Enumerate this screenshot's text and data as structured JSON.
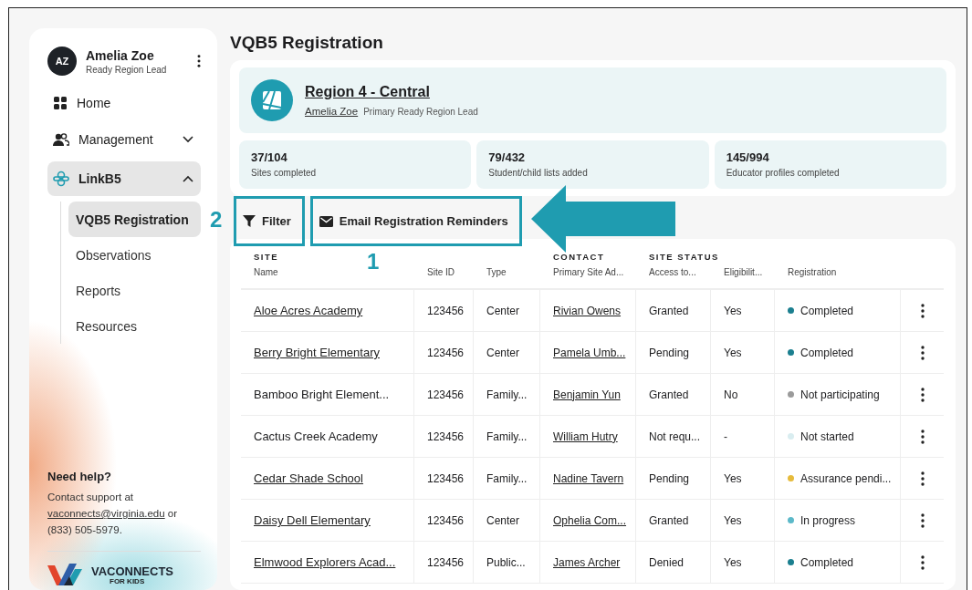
{
  "user": {
    "initials": "AZ",
    "name": "Amelia Zoe",
    "role": "Ready Region Lead"
  },
  "nav": [
    {
      "label": "Home",
      "selected": false
    },
    {
      "label": "Management",
      "selected": false,
      "expanded": false
    },
    {
      "label": "LinkB5",
      "selected": true,
      "expanded": true,
      "children": [
        {
          "label": "VQB5 Registration",
          "selected": true
        },
        {
          "label": "Observations",
          "selected": false
        },
        {
          "label": "Reports",
          "selected": false
        },
        {
          "label": "Resources",
          "selected": false
        }
      ]
    }
  ],
  "help": {
    "title": "Need help?",
    "text": "Contact support at",
    "email": "vaconnects@virginia.edu",
    "text_after": "or",
    "phone": "(833) 505-5979."
  },
  "logo": {
    "name": "VACONNECTS",
    "tagline": "FOR KIDS"
  },
  "page_title": "VQB5 Registration",
  "region": {
    "title": "Region 4 - Central",
    "lead": "Amelia Zoe",
    "lead_role": "Primary Ready Region Lead"
  },
  "stats": [
    {
      "value": "37/104",
      "label": "Sites completed"
    },
    {
      "value": "79/432",
      "label": "Student/child lists added"
    },
    {
      "value": "145/994",
      "label": "Educator profiles completed"
    }
  ],
  "actions": [
    {
      "label": "Filter",
      "annotation": "2"
    },
    {
      "label": "Email Registration Reminders",
      "annotation": "1"
    }
  ],
  "table": {
    "groups": [
      "SITE",
      "CONTACT",
      "SITE STATUS"
    ],
    "columns": [
      "Name",
      "Site ID",
      "Type",
      "Primary Site Ad...",
      "Access to...",
      "Eligibilit...",
      "Registration"
    ],
    "rows": [
      {
        "name": "Aloe Acres Academy",
        "link": true,
        "site_id": "123456",
        "type": "Center",
        "contact": "Rivian Owens",
        "access": "Granted",
        "eligibility": "Yes",
        "registration": "Completed",
        "color": "#1b7f8f"
      },
      {
        "name": "Berry Bright Elementary",
        "link": true,
        "site_id": "123456",
        "type": "Center",
        "contact": "Pamela Umb...",
        "access": "Pending",
        "eligibility": "Yes",
        "registration": "Completed",
        "color": "#1b7f8f"
      },
      {
        "name": "Bamboo Bright Element...",
        "link": false,
        "site_id": "123456",
        "type": "Family...",
        "contact": "Benjamin Yun",
        "access": "Granted",
        "eligibility": "No",
        "registration": "Not participating",
        "color": "#9b9b9b"
      },
      {
        "name": "Cactus Creek Academy",
        "link": false,
        "site_id": "123456",
        "type": "Family...",
        "contact": "William Hutry",
        "access": "Not requ...",
        "eligibility": "-",
        "registration": "Not started",
        "color": "#d9edf0"
      },
      {
        "name": "Cedar Shade School",
        "link": true,
        "site_id": "123456",
        "type": "Family...",
        "contact": "Nadine Tavern",
        "access": "Pending",
        "eligibility": "Yes",
        "registration": "Assurance pendi...",
        "color": "#e6bb3c"
      },
      {
        "name": "Daisy Dell Elementary",
        "link": true,
        "site_id": "123456",
        "type": "Center",
        "contact": "Ophelia Com...",
        "access": "Granted",
        "eligibility": "Yes",
        "registration": "In progress",
        "color": "#5cb9c9"
      },
      {
        "name": "Elmwood Explorers Acad...",
        "link": true,
        "site_id": "123456",
        "type": "Public...",
        "contact": "James Archer",
        "access": "Denied",
        "eligibility": "Yes",
        "registration": "Completed",
        "color": "#1b7f8f"
      }
    ]
  }
}
